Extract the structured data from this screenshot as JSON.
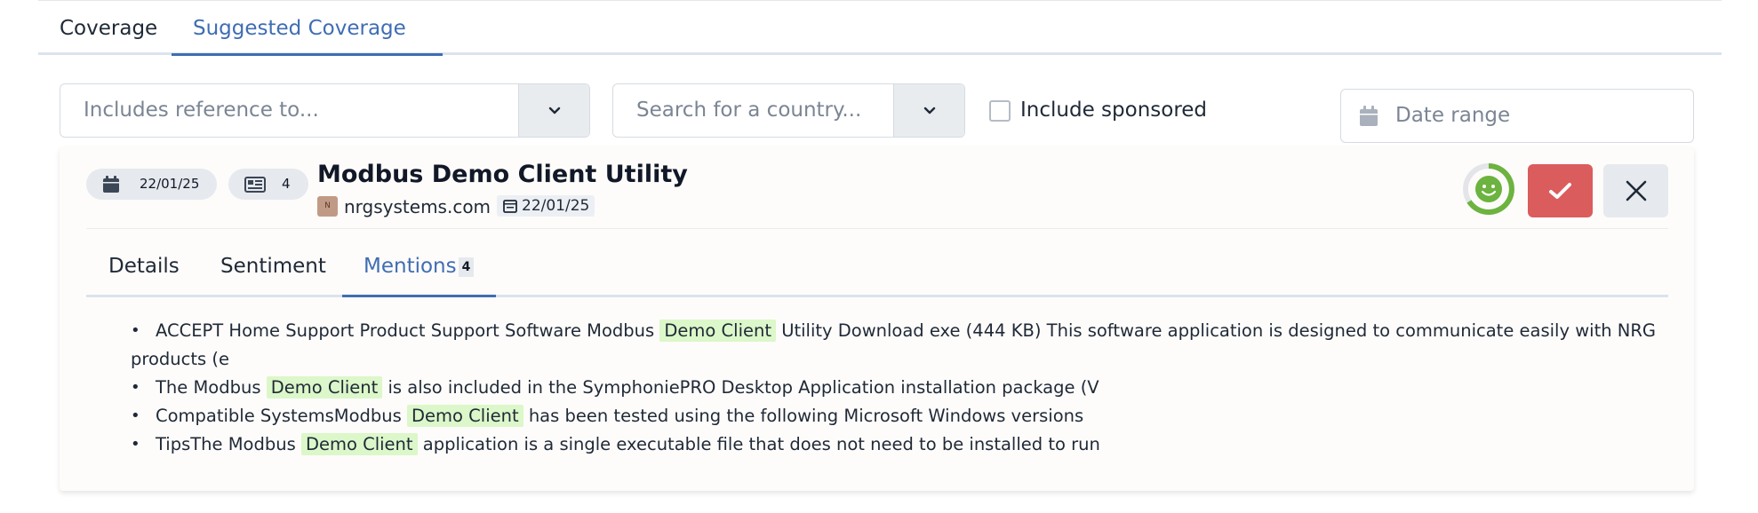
{
  "top_tabs": [
    "Coverage",
    "Suggested Coverage"
  ],
  "filters": {
    "reference_placeholder": "Includes reference to...",
    "country_placeholder": "Search for a country...",
    "include_sponsored_label": "Include sponsored",
    "date_range_placeholder": "Date range"
  },
  "article": {
    "date_pill": "22/01/25",
    "mentions_count_pill": "4",
    "title": "Modbus Demo Client Utility",
    "favicon_letter": "N",
    "source_domain": "nrgsystems.com",
    "published_date": "22/01/25",
    "sentiment_icon": "smiley-face-icon",
    "accept_icon": "check-icon",
    "reject_icon": "close-icon"
  },
  "article_tabs": {
    "details": "Details",
    "sentiment": "Sentiment",
    "mentions": "Mentions",
    "mentions_badge": "4"
  },
  "highlight_term": "Demo Client",
  "mentions": [
    {
      "before": "ACCEPT Home Support Product Support Software Modbus",
      "after": "Utility Download exe (444 KB) This software application is designed to communicate easily with NRG",
      "continuation": "products (e"
    },
    {
      "before": "The Modbus",
      "after": "is also included in the SymphoniePRO Desktop Application installation package (V"
    },
    {
      "before": "Compatible SystemsModbus",
      "after": "has been tested using the following Microsoft Windows versions"
    },
    {
      "before": "TipsThe Modbus",
      "after": "application is a single executable file that does not need to be installed to run"
    }
  ],
  "colors": {
    "accent": "#3f6db3",
    "accept_button": "#db5c5c",
    "highlight": "#dcf7c9",
    "sentiment_green": "#6cb33f"
  }
}
